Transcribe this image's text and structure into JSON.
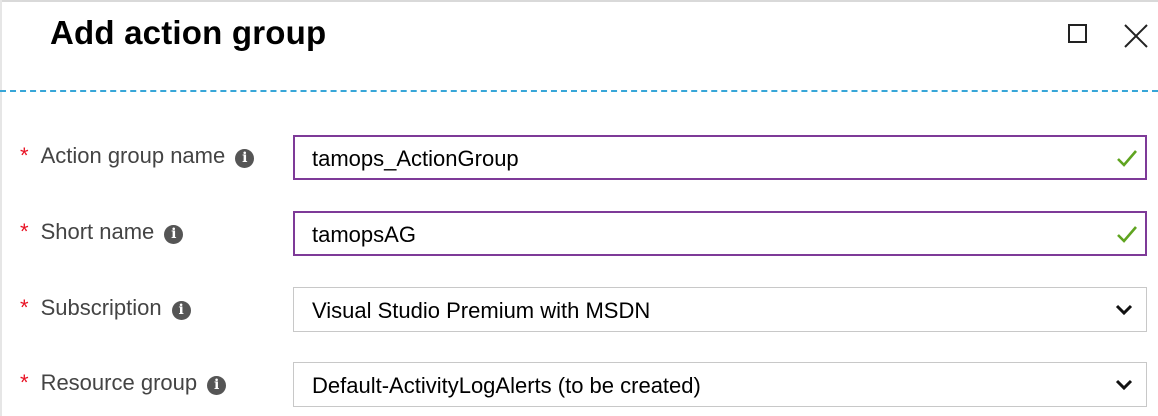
{
  "blade": {
    "title": "Add action group",
    "maximize_icon": "maximize-icon",
    "close_icon": "close-icon"
  },
  "form": {
    "fields": [
      {
        "label": "Action group name",
        "required_marker": "*",
        "info_icon": "info-icon",
        "value": "tamops_ActionGroup",
        "valid": true
      },
      {
        "label": "Short name",
        "required_marker": "*",
        "info_icon": "info-icon",
        "value": "tamopsAG",
        "valid": true
      },
      {
        "label": "Subscription",
        "required_marker": "*",
        "info_icon": "info-icon",
        "selected": "Visual Studio Premium with MSDN"
      },
      {
        "label": "Resource group",
        "required_marker": "*",
        "info_icon": "info-icon",
        "selected": "Default-ActivityLogAlerts (to be created)"
      }
    ]
  },
  "colors": {
    "required": "#e81123",
    "focus_border": "#7e3a98",
    "valid_check": "#5fa420",
    "divider": "#37a6d8"
  }
}
